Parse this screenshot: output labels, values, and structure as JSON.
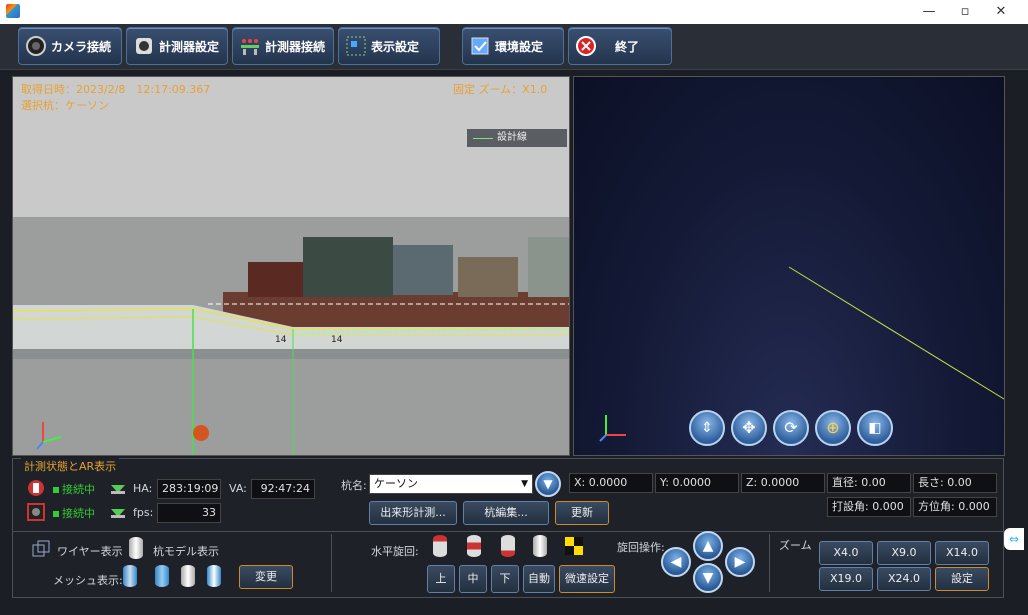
{
  "window": {
    "minimize": "—",
    "maximize": "▫",
    "close": "✕"
  },
  "toolbar": {
    "camera_connect": "カメラ接続",
    "instrument_settings": "計測器設定",
    "instrument_connect": "計測器接続",
    "display_settings": "表示設定",
    "environment_settings": "環境設定",
    "exit": "終了"
  },
  "camera_view": {
    "datetime_label": "取得日時：2023/2/8　12:17:09.367",
    "selected_pile": "選択杭：ケーソン",
    "zoom_text": "固定 ズーム：X1.0",
    "legend_design_line": "設計線",
    "markers": [
      "14",
      "14"
    ]
  },
  "viewer3d": {
    "nav_buttons": [
      "tilt",
      "pan",
      "rotate",
      "target",
      "cube"
    ]
  },
  "panel": {
    "legend": "計測状態とAR表示",
    "status1": "接続中",
    "status2": "接続中",
    "ha_label": "HA:",
    "ha_value": "283:19:09",
    "va_label": "VA:",
    "va_value": "92:47:24",
    "fps_label": "fps:",
    "fps_value": "33",
    "pile_name_label": "杭名:",
    "pile_name_value": "ケーソン",
    "x_field": "X: 0.0000",
    "y_field": "Y: 0.0000",
    "z_field": "Z: 0.0000",
    "diameter": "直径: 0.00",
    "length": "長さ: 0.00",
    "drive_angle": "打設角: 0.000",
    "azimuth": "方位角: 0.000",
    "btn_measure": "出来形計測...",
    "btn_edit_pile": "杭編集...",
    "btn_update": "更新",
    "wire_display": "ワイヤー表示",
    "pile_model_display": "杭モデル表示",
    "mesh_display": "メッシュ表示:",
    "btn_change": "変更",
    "horizontal_rotation": "水平旋回:",
    "rotation_op": "旋回操作:",
    "btn_top": "上",
    "btn_mid": "中",
    "btn_bottom": "下",
    "btn_auto": "自動",
    "btn_detail": "微速設定",
    "zoom_label": "ズーム",
    "zoom_buttons": [
      "X4.0",
      "X9.0",
      "X14.0",
      "X19.0",
      "X24.0"
    ],
    "btn_setting": "設定"
  },
  "colors": {
    "accent": "#e7a233",
    "status_green": "#33cc33",
    "button_blue": "#3a5070"
  }
}
